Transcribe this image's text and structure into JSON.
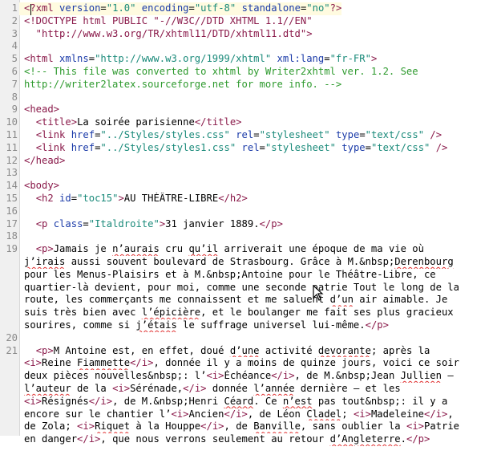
{
  "lines": [
    {
      "n": "1",
      "html": "<span class='p'>&lt;?</span><span class='t'>xml</span> <span class='a'>version</span>=<span class='s'>\"1.0\"</span> <span class='a'>encoding</span>=<span class='s'>\"utf-8\"</span> <span class='a'>standalone</span>=<span class='s'>\"no\"</span><span class='p'>?&gt;</span>",
      "current": true
    },
    {
      "n": "2",
      "html": "<span class='t'>&lt;!DOCTYPE html PUBLIC \"-//W3C//DTD XHTML 1.1//EN\"</span>"
    },
    {
      "n": "3",
      "html": "<span class='t'>  \"http://www.w3.org/TR/xhtml11/DTD/xhtml11.dtd\"&gt;</span>"
    },
    {
      "n": "4",
      "html": ""
    },
    {
      "n": "5",
      "html": "<span class='t'>&lt;html</span> <span class='a'>xmlns</span>=<span class='s'>\"http://www.w3.org/1999/xhtml\"</span> <span class='a'>xml:lang</span>=<span class='s'>\"fr-FR\"</span><span class='t'>&gt;</span>"
    },
    {
      "n": "6",
      "html": "<span class='c'>&lt;!-- This file was converted to xhtml by Writer2xhtml ver. 1.2. See</span>"
    },
    {
      "n": "7",
      "html": "<span class='c'>http://writer2latex.sourceforge.net for more info. --&gt;</span>"
    },
    {
      "n": "8",
      "html": ""
    },
    {
      "n": "9",
      "html": "<span class='t'>&lt;head&gt;</span>"
    },
    {
      "n": "10",
      "html": "  <span class='t'>&lt;title&gt;</span>La soirée parisienne<span class='t'>&lt;/title&gt;</span>"
    },
    {
      "n": "11",
      "html": "  <span class='t'>&lt;link</span> <span class='a'>href</span>=<span class='s'>\"../Styles/styles.css\"</span> <span class='a'>rel</span>=<span class='s'>\"stylesheet\"</span> <span class='a'>type</span>=<span class='s'>\"text/css\"</span> <span class='t'>/&gt;</span>"
    },
    {
      "n": "11",
      "html": "  <span class='t'>&lt;link</span> <span class='a'>href</span>=<span class='s'>\"../Styles/styles1.css\"</span> <span class='a'>rel</span>=<span class='s'>\"stylesheet\"</span> <span class='a'>type</span>=<span class='s'>\"text/css\"</span> <span class='t'>/&gt;</span>"
    },
    {
      "n": "12",
      "html": "<span class='t'>&lt;/head&gt;</span>"
    },
    {
      "n": "13",
      "html": ""
    },
    {
      "n": "14",
      "html": "<span class='t'>&lt;body&gt;</span>"
    },
    {
      "n": "15",
      "html": "  <span class='t'>&lt;h2</span> <span class='a'>id</span>=<span class='s'>\"toc15\"</span><span class='t'>&gt;</span>AU THÉÂTRE-LIBRE<span class='t'>&lt;/h2&gt;</span>"
    },
    {
      "n": "16",
      "html": ""
    },
    {
      "n": "17",
      "html": "  <span class='t'>&lt;p</span> <span class='a'>class</span>=<span class='s'>\"Italdroite\"</span><span class='t'>&gt;</span>31 janvier 1889.<span class='t'>&lt;/p&gt;</span>"
    },
    {
      "n": "18",
      "html": ""
    },
    {
      "n": "19",
      "html": "  <span class='t'>&lt;p&gt;</span>Jamais je <span class='sp'>n’aurais</span> cru <span class='sp'>qu’il</span> arriverait une époque de ma vie où"
    },
    {
      "n": "",
      "html": "<span class='sp'>j’irais</span> aussi souvent boulevard de Strasbourg. Grâce à M.&amp;nbsp;<span class='sp'>Derenbourg</span>"
    },
    {
      "n": "",
      "html": "pour les Menus-Plaisirs et à M.&amp;nbsp;Antoine pour le Théâtre-Libre, ce"
    },
    {
      "n": "",
      "html": "quartier-là devient, pour moi, comme une seconde patrie Tout le long de la"
    },
    {
      "n": "",
      "html": "route, les commerçants me connaissent et me saluent <span class='sp'>d’un</span> air aimable. Je"
    },
    {
      "n": "",
      "html": "suis très bien avec <span class='sp'>l’épicière</span>, et le boulanger me fait ses plus gracieux"
    },
    {
      "n": "",
      "html": "sourires, comme si <span class='sp'>j’étais</span> le suffrage universel lui-même.<span class='t'>&lt;/p&gt;</span>"
    },
    {
      "n": "20",
      "html": ""
    },
    {
      "n": "21",
      "html": "  <span class='t'>&lt;p&gt;</span>M Antoine est, en effet, doué <span class='sp'>d’une</span> activité <span class='sp'>devorante</span>; après la"
    },
    {
      "n": "",
      "html": "<span class='t'>&lt;i&gt;</span>Reine <span class='sp'>Fiammette</span><span class='t'>&lt;/i&gt;</span>, donnée il y a moins de quinze jours, voici ce soir"
    },
    {
      "n": "",
      "html": "deux pièces nouvelles&amp;nbsp;: l’<span class='t'>&lt;i&gt;</span>Échéance<span class='t'>&lt;/i&gt;</span>, de M.&amp;nbsp;Jean <span class='sp'>Jullien</span> –"
    },
    {
      "n": "",
      "html": "<span class='sp'>l’auteur</span> de la <span class='t'>&lt;i&gt;</span>Sérénade,<span class='t'>&lt;/i&gt;</span> donnée <span class='sp'>l’année</span> dernière – et les"
    },
    {
      "n": "",
      "html": "<span class='t'>&lt;i&gt;</span>Résignés<span class='t'>&lt;/i&gt;</span>, de M.&amp;nbsp;Henri <span class='sp'>Céard</span>. Ce <span class='sp'>n’est</span> pas tout&amp;nbsp;: il y a"
    },
    {
      "n": "",
      "html": "encore sur le chantier l’<span class='t'>&lt;i&gt;</span>Ancien<span class='t'>&lt;/i&gt;</span>, de Léon <span class='sp'>Cladel</span>; <span class='t'>&lt;i&gt;</span>Madeleine<span class='t'>&lt;/i&gt;</span>,"
    },
    {
      "n": "",
      "html": "de Zola; <span class='t'>&lt;i&gt;</span><span class='sp'>Riquet</span> à la Houppe<span class='t'>&lt;/i&gt;</span>, de <span class='sp'>Banville</span>, sans oublier la <span class='t'>&lt;i&gt;</span>Patrie"
    },
    {
      "n": "",
      "html": "en danger<span class='t'>&lt;/i&gt;</span>, que nous verrons seulement au retour <span class='sp'>d’Angleterre</span>.<span class='t'>&lt;/p&gt;</span>"
    },
    {
      "n": "",
      "html": ""
    }
  ]
}
